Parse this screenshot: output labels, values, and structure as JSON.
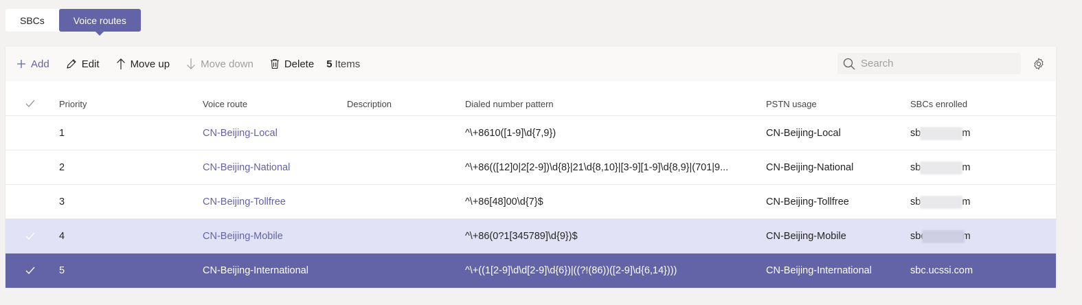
{
  "tabs": [
    {
      "label": "SBCs",
      "active": false
    },
    {
      "label": "Voice routes",
      "active": true
    }
  ],
  "toolbar": {
    "add_label": "Add",
    "edit_label": "Edit",
    "move_up_label": "Move up",
    "move_down_label": "Move down",
    "delete_label": "Delete",
    "items_count": "5",
    "items_label": "Items"
  },
  "search": {
    "placeholder": "Search"
  },
  "table": {
    "headers": {
      "priority": "Priority",
      "voice_route": "Voice route",
      "description": "Description",
      "pattern": "Dialed number pattern",
      "pstn": "PSTN usage",
      "sbcs": "SBCs enrolled"
    },
    "rows": [
      {
        "priority": "1",
        "route": "CN-Beijing-Local",
        "description": "",
        "pattern": "^\\+8610([1-9]\\d{7,9})",
        "pstn": "CN-Beijing-Local",
        "sbc_prefix": "sb",
        "sbc_suffix": "m"
      },
      {
        "priority": "2",
        "route": "CN-Beijing-National",
        "description": "",
        "pattern": "^\\+86(([12]0|2[2-9])\\d{8}|21\\d{8,10}|[3-9][1-9]\\d{8,9}|(701|9...",
        "pstn": "CN-Beijing-National",
        "sbc_prefix": "sb",
        "sbc_suffix": "m"
      },
      {
        "priority": "3",
        "route": "CN-Beijing-Tollfree",
        "description": "",
        "pattern": "^\\+86[48]00\\d{7}$",
        "pstn": "CN-Beijing-Tollfree",
        "sbc_prefix": "sb",
        "sbc_suffix": "m"
      },
      {
        "priority": "4",
        "route": "CN-Beijing-Mobile",
        "description": "",
        "pattern": "^\\+86(0?1[345789]\\d{9})$",
        "pstn": "CN-Beijing-Mobile",
        "sbc_prefix": "sbc",
        "sbc_suffix": "m"
      },
      {
        "priority": "5",
        "route": "CN-Beijing-International",
        "description": "",
        "pattern": "^\\+((1[2-9]\\d\\d[2-9]\\d{6})|((?!(86))([2-9]\\d{6,14})))",
        "pstn": "CN-Beijing-International",
        "sbc": "sbc.ucssi.com"
      }
    ]
  },
  "colors": {
    "accent": "#6264a7",
    "selected_light": "#e2e2f6",
    "background": "#f3f2f1"
  }
}
